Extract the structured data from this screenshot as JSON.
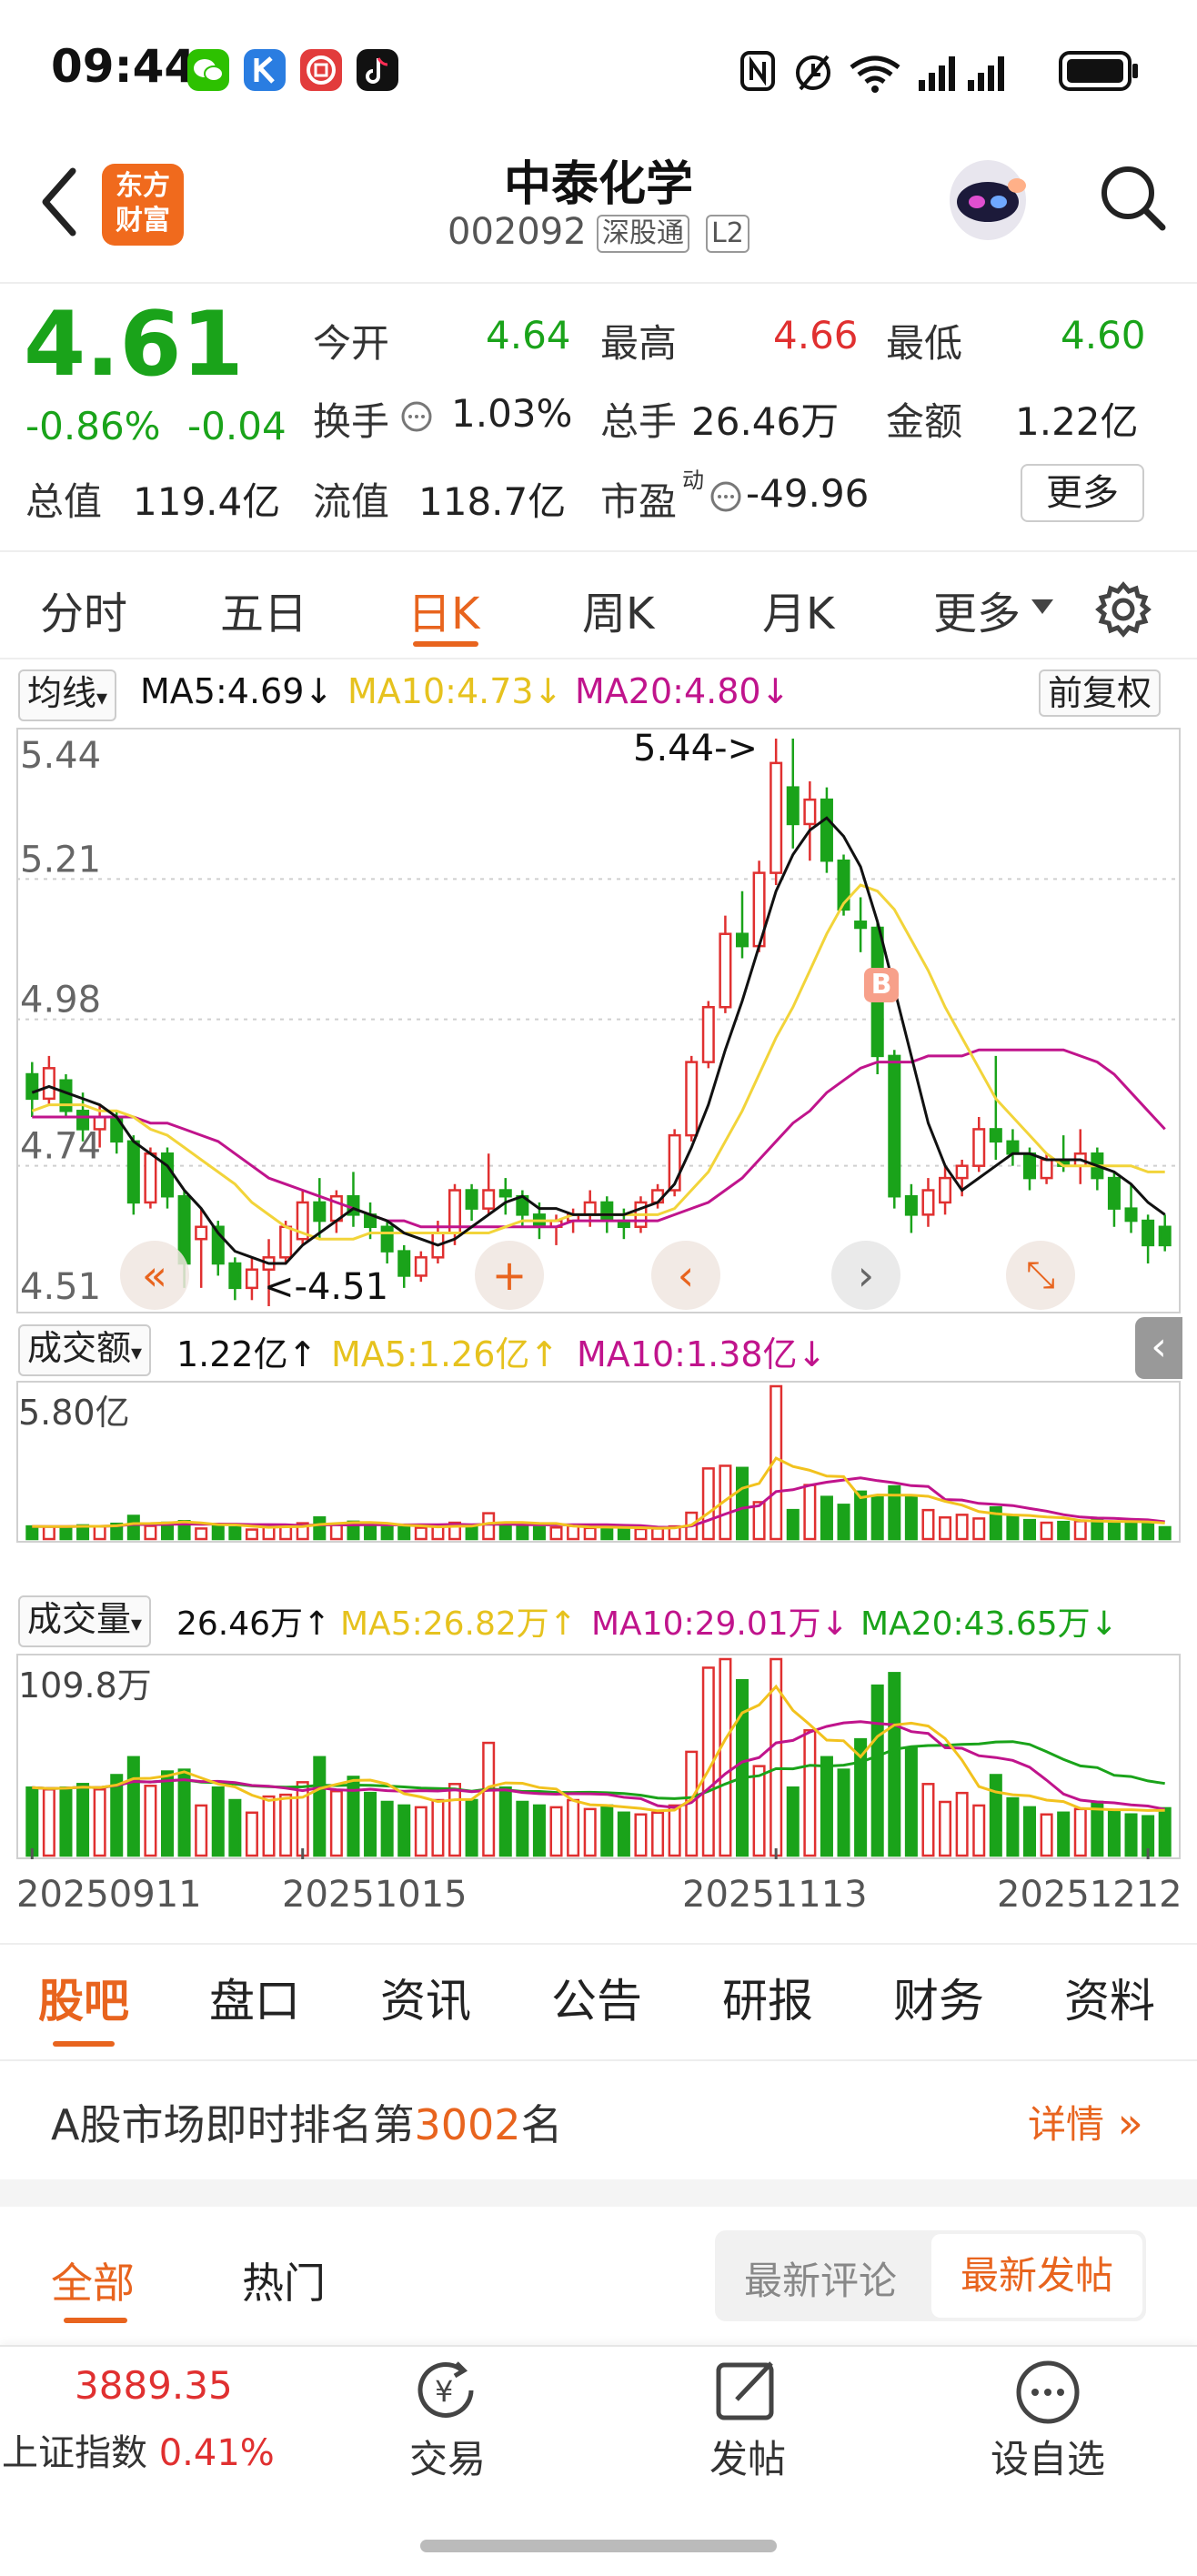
{
  "status_bar": {
    "time": "09:44"
  },
  "header": {
    "app_logo_text": [
      "东方",
      "财富"
    ],
    "title": "中泰化学",
    "code": "002092",
    "tags": [
      "深股通",
      "L2"
    ]
  },
  "quote": {
    "price": "4.61",
    "change_pct": "-0.86%",
    "change_abs": "-0.04",
    "market_value_label": "总值",
    "market_value": "119.4亿",
    "fields": [
      {
        "label": "今开",
        "value": "4.64"
      },
      {
        "label": "最高",
        "value": "4.66"
      },
      {
        "label": "最低",
        "value": "4.60"
      },
      {
        "label": "换手",
        "value": "1.03%"
      },
      {
        "label": "总手",
        "value": "26.46万"
      },
      {
        "label": "金额",
        "value": "1.22亿"
      },
      {
        "label": "流值",
        "value": "118.7亿"
      },
      {
        "label": "市盈",
        "sup": "动",
        "value": "-49.96"
      }
    ],
    "more_button": "更多"
  },
  "chart_tabs": {
    "items": [
      "分时",
      "五日",
      "日K",
      "周K",
      "月K",
      "更多"
    ],
    "active": 2
  },
  "kline": {
    "indicator_select": "均线",
    "ma5": "MA5:4.69",
    "ma10": "MA10:4.73",
    "ma20": "MA20:4.80",
    "adjust_button": "前复权",
    "max_marker": "5.44->",
    "min_marker": "<-4.51",
    "b_marker": "B",
    "colors": {
      "up": "#e03030",
      "down": "#1aa31a",
      "ma5": "#111111",
      "ma10": "#f2d43a",
      "ma20": "#c0148c"
    }
  },
  "amount_panel": {
    "select": "成交额",
    "value": "1.22亿",
    "ma5": "MA5:1.26亿",
    "ma10": "MA10:1.38亿",
    "top_label": "5.80亿"
  },
  "volume_panel": {
    "select": "成交量",
    "value": "26.46万",
    "ma5": "MA5:26.82万",
    "ma10": "MA10:29.01万",
    "ma20": "MA20:43.65万",
    "top_label": "109.8万"
  },
  "chart_data": {
    "type": "candlestick",
    "y_ticks": [
      "5.44",
      "5.21",
      "4.98",
      "4.74",
      "4.51"
    ],
    "ylim": [
      4.51,
      5.44
    ],
    "x_ticks": [
      "20250911",
      "20251015",
      "20251113",
      "20251212"
    ],
    "ohlc": [
      [
        4.89,
        4.91,
        4.82,
        4.85
      ],
      [
        4.85,
        4.92,
        4.84,
        4.9
      ],
      [
        4.88,
        4.89,
        4.82,
        4.83
      ],
      [
        4.83,
        4.86,
        4.78,
        4.8
      ],
      [
        4.8,
        4.84,
        4.77,
        4.82
      ],
      [
        4.82,
        4.83,
        4.76,
        4.78
      ],
      [
        4.78,
        4.79,
        4.66,
        4.68
      ],
      [
        4.68,
        4.77,
        4.67,
        4.76
      ],
      [
        4.76,
        4.77,
        4.67,
        4.69
      ],
      [
        4.69,
        4.7,
        4.54,
        4.58
      ],
      [
        4.62,
        4.67,
        4.54,
        4.64
      ],
      [
        4.64,
        4.65,
        4.56,
        4.58
      ],
      [
        4.58,
        4.59,
        4.52,
        4.54
      ],
      [
        4.54,
        4.59,
        4.52,
        4.57
      ],
      [
        4.57,
        4.62,
        4.51,
        4.59
      ],
      [
        4.59,
        4.65,
        4.58,
        4.64
      ],
      [
        4.62,
        4.7,
        4.61,
        4.68
      ],
      [
        4.68,
        4.72,
        4.62,
        4.65
      ],
      [
        4.65,
        4.7,
        4.63,
        4.69
      ],
      [
        4.69,
        4.73,
        4.64,
        4.66
      ],
      [
        4.66,
        4.68,
        4.62,
        4.64
      ],
      [
        4.64,
        4.65,
        4.58,
        4.6
      ],
      [
        4.6,
        4.61,
        4.54,
        4.56
      ],
      [
        4.56,
        4.6,
        4.55,
        4.59
      ],
      [
        4.59,
        4.65,
        4.58,
        4.63
      ],
      [
        4.63,
        4.71,
        4.61,
        4.7
      ],
      [
        4.7,
        4.71,
        4.65,
        4.67
      ],
      [
        4.67,
        4.76,
        4.66,
        4.7
      ],
      [
        4.7,
        4.72,
        4.66,
        4.69
      ],
      [
        4.69,
        4.7,
        4.64,
        4.66
      ],
      [
        4.66,
        4.68,
        4.62,
        4.64
      ],
      [
        4.64,
        4.66,
        4.61,
        4.65
      ],
      [
        4.65,
        4.67,
        4.63,
        4.66
      ],
      [
        4.66,
        4.7,
        4.64,
        4.68
      ],
      [
        4.68,
        4.69,
        4.63,
        4.65
      ],
      [
        4.65,
        4.67,
        4.62,
        4.64
      ],
      [
        4.64,
        4.69,
        4.63,
        4.68
      ],
      [
        4.68,
        4.71,
        4.67,
        4.7
      ],
      [
        4.7,
        4.8,
        4.69,
        4.79
      ],
      [
        4.79,
        4.92,
        4.78,
        4.91
      ],
      [
        4.91,
        5.01,
        4.9,
        5.0
      ],
      [
        5.0,
        5.15,
        4.99,
        5.12
      ],
      [
        5.12,
        5.19,
        5.08,
        5.1
      ],
      [
        5.1,
        5.24,
        5.09,
        5.22
      ],
      [
        5.22,
        5.44,
        5.2,
        5.4
      ],
      [
        5.36,
        5.44,
        5.26,
        5.3
      ],
      [
        5.3,
        5.37,
        5.24,
        5.34
      ],
      [
        5.34,
        5.36,
        5.22,
        5.24
      ],
      [
        5.24,
        5.25,
        5.15,
        5.16
      ],
      [
        5.14,
        5.18,
        5.09,
        5.13
      ],
      [
        5.13,
        5.14,
        4.89,
        4.92
      ],
      [
        4.92,
        4.93,
        4.67,
        4.69
      ],
      [
        4.69,
        4.71,
        4.63,
        4.66
      ],
      [
        4.66,
        4.72,
        4.64,
        4.7
      ],
      [
        4.68,
        4.74,
        4.66,
        4.72
      ],
      [
        4.72,
        4.75,
        4.69,
        4.74
      ],
      [
        4.74,
        4.82,
        4.73,
        4.8
      ],
      [
        4.8,
        4.92,
        4.75,
        4.78
      ],
      [
        4.78,
        4.8,
        4.74,
        4.76
      ],
      [
        4.76,
        4.77,
        4.7,
        4.72
      ],
      [
        4.72,
        4.76,
        4.71,
        4.75
      ],
      [
        4.75,
        4.79,
        4.73,
        4.74
      ],
      [
        4.74,
        4.8,
        4.71,
        4.76
      ],
      [
        4.76,
        4.77,
        4.7,
        4.72
      ],
      [
        4.72,
        4.73,
        4.64,
        4.67
      ],
      [
        4.67,
        4.71,
        4.63,
        4.65
      ],
      [
        4.65,
        4.66,
        4.58,
        4.61
      ],
      [
        4.64,
        4.66,
        4.6,
        4.61
      ]
    ],
    "ma5": [
      4.86,
      4.87,
      4.86,
      4.85,
      4.84,
      4.82,
      4.78,
      4.76,
      4.74,
      4.7,
      4.67,
      4.63,
      4.6,
      4.59,
      4.58,
      4.58,
      4.61,
      4.63,
      4.65,
      4.67,
      4.66,
      4.65,
      4.63,
      4.62,
      4.61,
      4.62,
      4.64,
      4.66,
      4.68,
      4.69,
      4.67,
      4.67,
      4.66,
      4.66,
      4.66,
      4.66,
      4.67,
      4.68,
      4.71,
      4.77,
      4.84,
      4.93,
      5.01,
      5.1,
      5.19,
      5.25,
      5.29,
      5.31,
      5.28,
      5.23,
      5.14,
      5.03,
      4.92,
      4.81,
      4.74,
      4.7,
      4.72,
      4.74,
      4.76,
      4.76,
      4.75,
      4.75,
      4.75,
      4.74,
      4.73,
      4.71,
      4.68,
      4.66
    ],
    "ma10": [
      4.83,
      4.84,
      4.84,
      4.84,
      4.83,
      4.83,
      4.82,
      4.8,
      4.79,
      4.77,
      4.75,
      4.73,
      4.71,
      4.68,
      4.66,
      4.64,
      4.63,
      4.62,
      4.62,
      4.62,
      4.63,
      4.63,
      4.63,
      4.63,
      4.63,
      4.63,
      4.63,
      4.63,
      4.64,
      4.65,
      4.65,
      4.65,
      4.66,
      4.66,
      4.66,
      4.66,
      4.66,
      4.66,
      4.67,
      4.7,
      4.73,
      4.78,
      4.83,
      4.89,
      4.95,
      5.0,
      5.06,
      5.12,
      5.17,
      5.2,
      5.19,
      5.16,
      5.11,
      5.06,
      5.0,
      4.95,
      4.9,
      4.85,
      4.82,
      4.79,
      4.76,
      4.74,
      4.74,
      4.74,
      4.74,
      4.74,
      4.73,
      4.73
    ],
    "ma20": [
      4.82,
      4.82,
      4.82,
      4.82,
      4.82,
      4.82,
      4.82,
      4.81,
      4.81,
      4.8,
      4.79,
      4.78,
      4.76,
      4.74,
      4.72,
      4.71,
      4.7,
      4.69,
      4.68,
      4.67,
      4.66,
      4.65,
      4.65,
      4.64,
      4.64,
      4.64,
      4.64,
      4.64,
      4.64,
      4.64,
      4.64,
      4.64,
      4.65,
      4.65,
      4.65,
      4.65,
      4.65,
      4.65,
      4.66,
      4.67,
      4.68,
      4.7,
      4.72,
      4.75,
      4.78,
      4.81,
      4.83,
      4.86,
      4.88,
      4.9,
      4.91,
      4.91,
      4.91,
      4.92,
      4.92,
      4.92,
      4.93,
      4.93,
      4.93,
      4.93,
      4.93,
      4.93,
      4.92,
      4.91,
      4.89,
      4.86,
      4.83,
      4.8
    ],
    "amount": [
      0.48,
      0.47,
      0.47,
      0.52,
      0.48,
      0.58,
      0.88,
      0.5,
      0.62,
      0.68,
      0.4,
      0.55,
      0.44,
      0.36,
      0.48,
      0.5,
      0.6,
      0.82,
      0.55,
      0.66,
      0.52,
      0.45,
      0.44,
      0.43,
      0.48,
      0.62,
      0.48,
      0.98,
      0.6,
      0.48,
      0.45,
      0.44,
      0.5,
      0.42,
      0.45,
      0.4,
      0.38,
      0.4,
      0.48,
      1.0,
      2.68,
      2.78,
      2.7,
      1.4,
      5.8,
      1.1,
      2.05,
      1.6,
      1.3,
      1.8,
      1.62,
      2.0,
      1.6,
      1.1,
      0.82,
      0.92,
      0.78,
      1.2,
      0.85,
      0.72,
      0.62,
      0.65,
      0.68,
      0.75,
      0.65,
      0.6,
      0.58,
      0.45
    ],
    "volume": [
      38.0,
      37.0,
      38.0,
      40.0,
      37.0,
      45.0,
      55.0,
      39.0,
      47.0,
      48.0,
      28.0,
      38.0,
      31.0,
      24.0,
      33.0,
      34.0,
      41.0,
      55.0,
      36.0,
      44.0,
      35.0,
      30.0,
      28.0,
      27.0,
      31.0,
      40.0,
      31.0,
      63.0,
      38.0,
      30.0,
      28.0,
      27.0,
      31.0,
      26.0,
      28.0,
      24.0,
      23.0,
      24.0,
      28.0,
      58.0,
      105.0,
      109.8,
      98.0,
      50.0,
      109.8,
      38.0,
      70.0,
      55.0,
      48.0,
      65.0,
      95.0,
      102.0,
      60.0,
      40.0,
      30.0,
      35.0,
      28.0,
      45.0,
      32.0,
      27.0,
      23.0,
      24.0,
      26.0,
      30.0,
      25.0,
      23.0,
      22.0,
      26.46
    ]
  },
  "content_tabs": {
    "items": [
      "股吧",
      "盘口",
      "资讯",
      "公告",
      "研报",
      "财务",
      "资料"
    ],
    "active": 0
  },
  "ranking": {
    "prefix": "A股市场即时排名第",
    "rank": "3002",
    "suffix": "名",
    "detail": "详情"
  },
  "feed_tabs": {
    "left": [
      "全部",
      "热门"
    ],
    "right": [
      "最新评论",
      "最新发帖"
    ]
  },
  "bottom_bar": {
    "index_value": "3889.35",
    "index_name": "上证指数",
    "index_change": "0.41%",
    "items": [
      "交易",
      "发帖",
      "设自选"
    ]
  }
}
